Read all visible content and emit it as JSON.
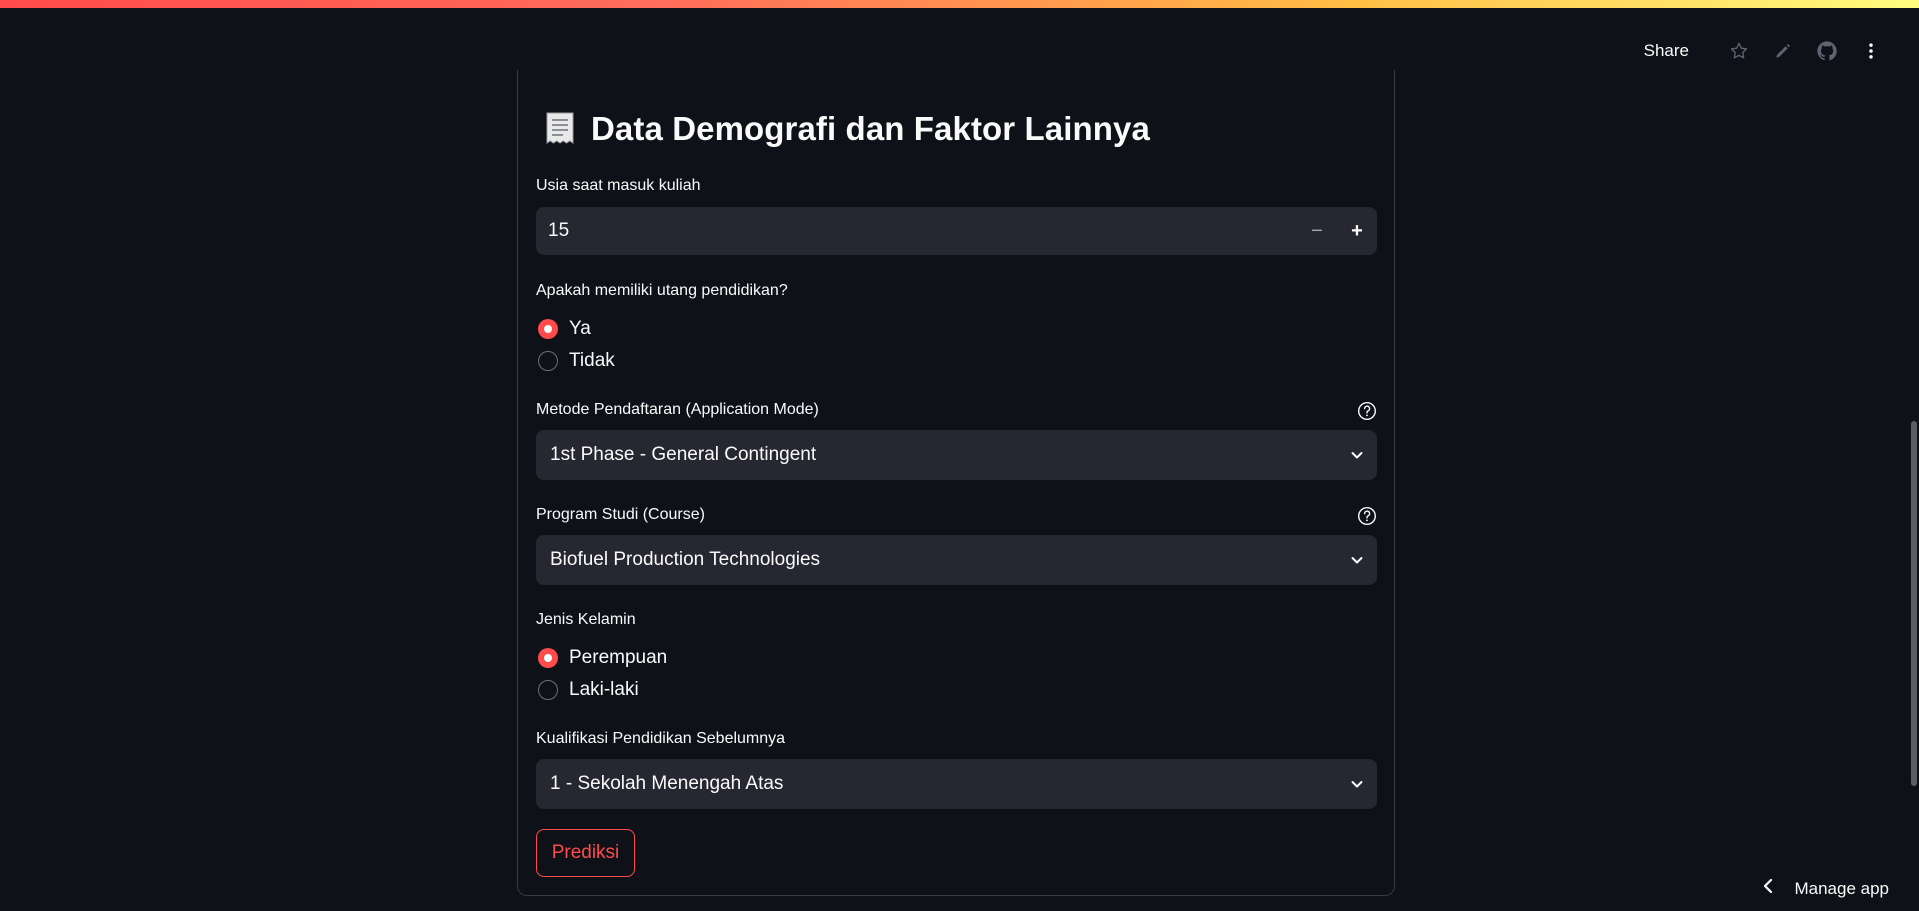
{
  "header": {
    "share_label": "Share",
    "icons": [
      "star-icon",
      "edit-icon",
      "github-icon",
      "more-vertical-icon"
    ]
  },
  "page": {
    "title_icon": "receipt-emoji",
    "title": "Data Demografi dan Faktor Lainnya"
  },
  "form": {
    "age": {
      "label": "Usia saat masuk kuliah",
      "value": "15",
      "decrement": "−",
      "increment": "+"
    },
    "debt": {
      "label": "Apakah memiliki utang pendidikan?",
      "options": [
        "Ya",
        "Tidak"
      ],
      "selected": "Ya"
    },
    "application_mode": {
      "label": "Metode Pendaftaran (Application Mode)",
      "value": "1st Phase - General Contingent"
    },
    "course": {
      "label": "Program Studi (Course)",
      "value": "Biofuel Production Technologies"
    },
    "gender": {
      "label": "Jenis Kelamin",
      "options": [
        "Perempuan",
        "Laki-laki"
      ],
      "selected": "Perempuan"
    },
    "prev_qualification": {
      "label": "Kualifikasi Pendidikan Sebelumnya",
      "value": "1 - Sekolah Menengah Atas"
    },
    "submit_label": "Prediksi"
  },
  "footer": {
    "manage_app_label": "Manage app"
  },
  "colors": {
    "background": "#0e1117",
    "field": "#262730",
    "accent": "#ff4b4b",
    "text": "#fafafa"
  }
}
